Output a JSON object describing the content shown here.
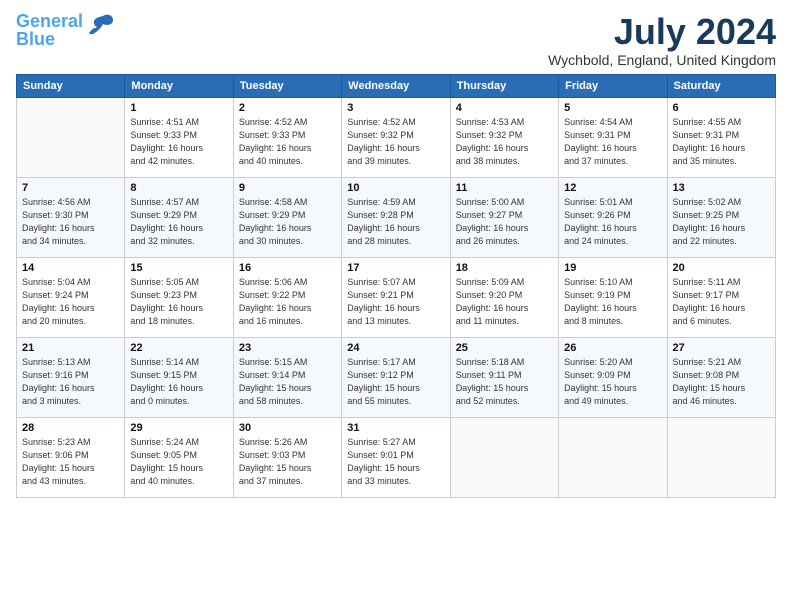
{
  "logo": {
    "line1": "General",
    "line2": "Blue"
  },
  "title": "July 2024",
  "location": "Wychbold, England, United Kingdom",
  "weekdays": [
    "Sunday",
    "Monday",
    "Tuesday",
    "Wednesday",
    "Thursday",
    "Friday",
    "Saturday"
  ],
  "weeks": [
    [
      {
        "day": "",
        "info": ""
      },
      {
        "day": "1",
        "info": "Sunrise: 4:51 AM\nSunset: 9:33 PM\nDaylight: 16 hours\nand 42 minutes."
      },
      {
        "day": "2",
        "info": "Sunrise: 4:52 AM\nSunset: 9:33 PM\nDaylight: 16 hours\nand 40 minutes."
      },
      {
        "day": "3",
        "info": "Sunrise: 4:52 AM\nSunset: 9:32 PM\nDaylight: 16 hours\nand 39 minutes."
      },
      {
        "day": "4",
        "info": "Sunrise: 4:53 AM\nSunset: 9:32 PM\nDaylight: 16 hours\nand 38 minutes."
      },
      {
        "day": "5",
        "info": "Sunrise: 4:54 AM\nSunset: 9:31 PM\nDaylight: 16 hours\nand 37 minutes."
      },
      {
        "day": "6",
        "info": "Sunrise: 4:55 AM\nSunset: 9:31 PM\nDaylight: 16 hours\nand 35 minutes."
      }
    ],
    [
      {
        "day": "7",
        "info": "Sunrise: 4:56 AM\nSunset: 9:30 PM\nDaylight: 16 hours\nand 34 minutes."
      },
      {
        "day": "8",
        "info": "Sunrise: 4:57 AM\nSunset: 9:29 PM\nDaylight: 16 hours\nand 32 minutes."
      },
      {
        "day": "9",
        "info": "Sunrise: 4:58 AM\nSunset: 9:29 PM\nDaylight: 16 hours\nand 30 minutes."
      },
      {
        "day": "10",
        "info": "Sunrise: 4:59 AM\nSunset: 9:28 PM\nDaylight: 16 hours\nand 28 minutes."
      },
      {
        "day": "11",
        "info": "Sunrise: 5:00 AM\nSunset: 9:27 PM\nDaylight: 16 hours\nand 26 minutes."
      },
      {
        "day": "12",
        "info": "Sunrise: 5:01 AM\nSunset: 9:26 PM\nDaylight: 16 hours\nand 24 minutes."
      },
      {
        "day": "13",
        "info": "Sunrise: 5:02 AM\nSunset: 9:25 PM\nDaylight: 16 hours\nand 22 minutes."
      }
    ],
    [
      {
        "day": "14",
        "info": "Sunrise: 5:04 AM\nSunset: 9:24 PM\nDaylight: 16 hours\nand 20 minutes."
      },
      {
        "day": "15",
        "info": "Sunrise: 5:05 AM\nSunset: 9:23 PM\nDaylight: 16 hours\nand 18 minutes."
      },
      {
        "day": "16",
        "info": "Sunrise: 5:06 AM\nSunset: 9:22 PM\nDaylight: 16 hours\nand 16 minutes."
      },
      {
        "day": "17",
        "info": "Sunrise: 5:07 AM\nSunset: 9:21 PM\nDaylight: 16 hours\nand 13 minutes."
      },
      {
        "day": "18",
        "info": "Sunrise: 5:09 AM\nSunset: 9:20 PM\nDaylight: 16 hours\nand 11 minutes."
      },
      {
        "day": "19",
        "info": "Sunrise: 5:10 AM\nSunset: 9:19 PM\nDaylight: 16 hours\nand 8 minutes."
      },
      {
        "day": "20",
        "info": "Sunrise: 5:11 AM\nSunset: 9:17 PM\nDaylight: 16 hours\nand 6 minutes."
      }
    ],
    [
      {
        "day": "21",
        "info": "Sunrise: 5:13 AM\nSunset: 9:16 PM\nDaylight: 16 hours\nand 3 minutes."
      },
      {
        "day": "22",
        "info": "Sunrise: 5:14 AM\nSunset: 9:15 PM\nDaylight: 16 hours\nand 0 minutes."
      },
      {
        "day": "23",
        "info": "Sunrise: 5:15 AM\nSunset: 9:14 PM\nDaylight: 15 hours\nand 58 minutes."
      },
      {
        "day": "24",
        "info": "Sunrise: 5:17 AM\nSunset: 9:12 PM\nDaylight: 15 hours\nand 55 minutes."
      },
      {
        "day": "25",
        "info": "Sunrise: 5:18 AM\nSunset: 9:11 PM\nDaylight: 15 hours\nand 52 minutes."
      },
      {
        "day": "26",
        "info": "Sunrise: 5:20 AM\nSunset: 9:09 PM\nDaylight: 15 hours\nand 49 minutes."
      },
      {
        "day": "27",
        "info": "Sunrise: 5:21 AM\nSunset: 9:08 PM\nDaylight: 15 hours\nand 46 minutes."
      }
    ],
    [
      {
        "day": "28",
        "info": "Sunrise: 5:23 AM\nSunset: 9:06 PM\nDaylight: 15 hours\nand 43 minutes."
      },
      {
        "day": "29",
        "info": "Sunrise: 5:24 AM\nSunset: 9:05 PM\nDaylight: 15 hours\nand 40 minutes."
      },
      {
        "day": "30",
        "info": "Sunrise: 5:26 AM\nSunset: 9:03 PM\nDaylight: 15 hours\nand 37 minutes."
      },
      {
        "day": "31",
        "info": "Sunrise: 5:27 AM\nSunset: 9:01 PM\nDaylight: 15 hours\nand 33 minutes."
      },
      {
        "day": "",
        "info": ""
      },
      {
        "day": "",
        "info": ""
      },
      {
        "day": "",
        "info": ""
      }
    ]
  ]
}
